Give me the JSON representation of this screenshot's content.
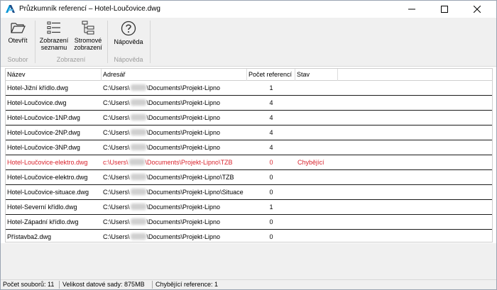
{
  "window": {
    "title": "Průzkumník referencí – Hotel-Loučovice.dwg",
    "accent": "#0696d7"
  },
  "ribbon": {
    "open_label": "Otevřít",
    "list_view_label_1": "Zobrazení",
    "list_view_label_2": "seznamu",
    "tree_view_label_1": "Stromové",
    "tree_view_label_2": "zobrazení",
    "help_label": "Nápověda",
    "group_file": "Soubor",
    "group_view": "Zobrazení",
    "group_help": "Nápověda"
  },
  "table": {
    "headers": [
      "Název",
      "Adresář",
      "Počet referencí",
      "Stav"
    ],
    "rows": [
      {
        "name": "Hotel-Jižní křídlo.dwg",
        "path_prefix": "C:\\Users\\",
        "path_suffix": "\\Documents\\Projekt-Lipno",
        "count": "1",
        "state": "",
        "missing": false
      },
      {
        "name": "Hotel-Loučovice.dwg",
        "path_prefix": "C:\\Users\\",
        "path_suffix": "\\Documents\\Projekt-Lipno",
        "count": "4",
        "state": "",
        "missing": false
      },
      {
        "name": "Hotel-Loučovice-1NP.dwg",
        "path_prefix": "C:\\Users\\",
        "path_suffix": "\\Documents\\Projekt-Lipno",
        "count": "4",
        "state": "",
        "missing": false
      },
      {
        "name": "Hotel-Loučovice-2NP.dwg",
        "path_prefix": "C:\\Users\\",
        "path_suffix": "\\Documents\\Projekt-Lipno",
        "count": "4",
        "state": "",
        "missing": false
      },
      {
        "name": "Hotel-Loučovice-3NP.dwg",
        "path_prefix": "C:\\Users\\",
        "path_suffix": "\\Documents\\Projekt-Lipno",
        "count": "4",
        "state": "",
        "missing": false
      },
      {
        "name": "Hotel-Loučovice-elektro.dwg",
        "path_prefix": "c:\\Users\\",
        "path_suffix": "\\Documents\\Projekt-Lipno\\TZB",
        "count": "0",
        "state": "Chybějící",
        "missing": true
      },
      {
        "name": "Hotel-Loučovice-elektro.dwg",
        "path_prefix": "C:\\Users\\",
        "path_suffix": "\\Documents\\Projekt-Lipno\\TZB",
        "count": "0",
        "state": "",
        "missing": false
      },
      {
        "name": "Hotel-Loučovice-situace.dwg",
        "path_prefix": "C:\\Users\\",
        "path_suffix": "\\Documents\\Projekt-Lipno\\Situace",
        "count": "0",
        "state": "",
        "missing": false
      },
      {
        "name": "Hotel-Severní křídlo.dwg",
        "path_prefix": "C:\\Users\\",
        "path_suffix": "\\Documents\\Projekt-Lipno",
        "count": "1",
        "state": "",
        "missing": false
      },
      {
        "name": "Hotel-Západní křídlo.dwg",
        "path_prefix": "C:\\Users\\",
        "path_suffix": "\\Documents\\Projekt-Lipno",
        "count": "0",
        "state": "",
        "missing": false
      },
      {
        "name": "Přístavba2.dwg",
        "path_prefix": "C:\\Users\\",
        "path_suffix": "\\Documents\\Projekt-Lipno",
        "count": "0",
        "state": "",
        "missing": false
      }
    ],
    "missing_color": "#d9232d"
  },
  "status": {
    "file_count": "Počet souborů: 11",
    "dataset_size": "Velikost datové sady: 875MB",
    "missing_refs": "Chybějící reference: 1"
  }
}
